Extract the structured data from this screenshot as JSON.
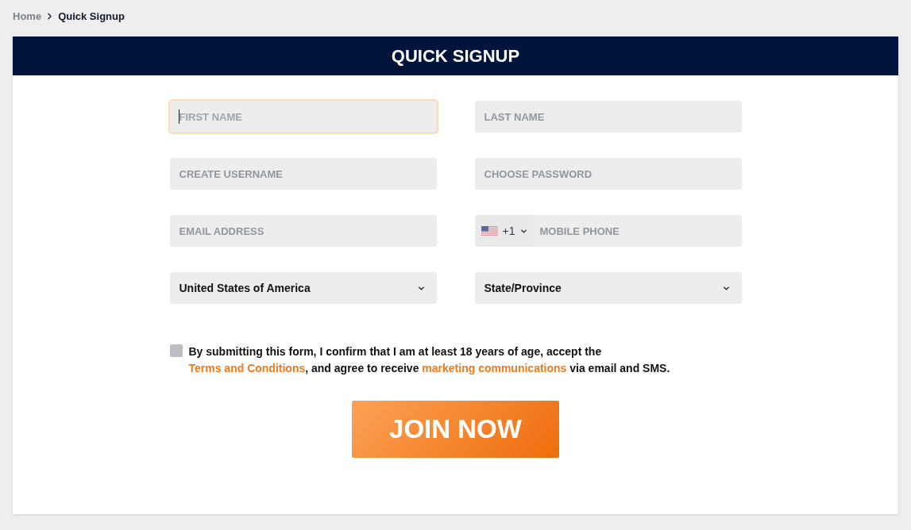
{
  "breadcrumb": [
    {
      "label": "Home",
      "current": false
    },
    {
      "label": "Quick Signup",
      "current": true
    }
  ],
  "header": {
    "title": "QUICK SIGNUP"
  },
  "fields": [
    {
      "kind": "text",
      "placeholder": "FIRST NAME",
      "focused": true
    },
    {
      "kind": "text",
      "placeholder": "LAST NAME",
      "focused": false
    },
    {
      "kind": "text",
      "placeholder": "CREATE USERNAME",
      "focused": false
    },
    {
      "kind": "text",
      "placeholder": "CHOOSE PASSWORD",
      "focused": false
    },
    {
      "kind": "text",
      "placeholder": "EMAIL ADDRESS",
      "focused": false
    },
    {
      "kind": "phone",
      "country_code": "+1",
      "placeholder": "MOBILE PHONE",
      "focused": false
    },
    {
      "kind": "select",
      "value": "United States of America",
      "focused": false
    },
    {
      "kind": "select",
      "value": "State/Province",
      "focused": false
    }
  ],
  "consent": {
    "checked": false,
    "parts": [
      {
        "kind": "text",
        "text": "By submitting this form, I confirm that I am at least 18 years of age, accept the "
      },
      {
        "kind": "link",
        "text": "Terms and Conditions"
      },
      {
        "kind": "text",
        "text": ", and agree to receive "
      },
      {
        "kind": "link",
        "text": "marketing communications"
      },
      {
        "kind": "text",
        "text": " via email and SMS."
      }
    ]
  },
  "submit": {
    "label": "JOIN NOW"
  }
}
